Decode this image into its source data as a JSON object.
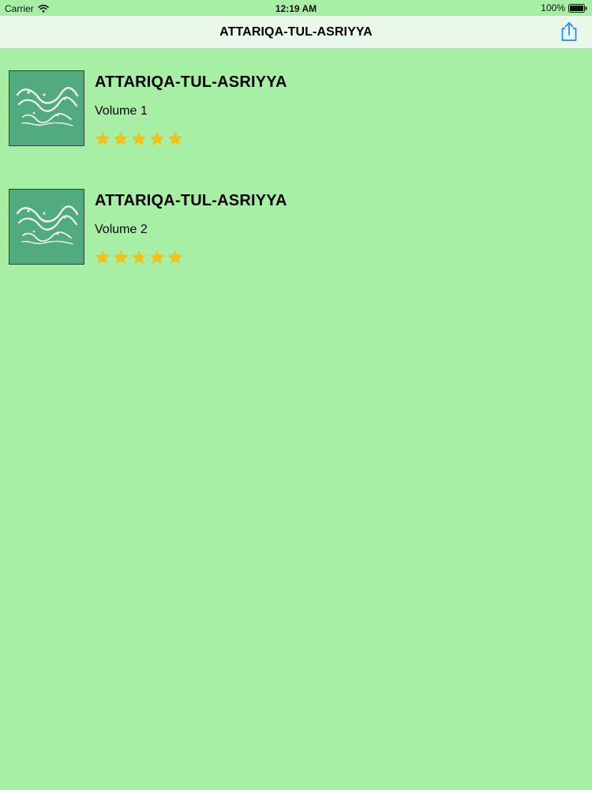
{
  "status_bar": {
    "carrier": "Carrier",
    "time": "12:19 AM",
    "battery": "100%",
    "wifi_icon": "wifi-icon",
    "battery_icon": "battery-icon"
  },
  "nav": {
    "title": "ATTARIQA-TUL-ASRIYYA",
    "share_icon": "share-icon"
  },
  "colors": {
    "background": "#a8efa6",
    "nav_background": "#e9f8e8",
    "accent": "#1e88ff",
    "star": "#f1c21b",
    "cover": "#4ea87a"
  },
  "books": [
    {
      "title": "ATTARIQA-TUL-ASRIYYA",
      "subtitle": "Volume 1",
      "rating": 5,
      "rating_max": 5
    },
    {
      "title": "ATTARIQA-TUL-ASRIYYA",
      "subtitle": "Volume 2",
      "rating": 5,
      "rating_max": 5
    }
  ]
}
